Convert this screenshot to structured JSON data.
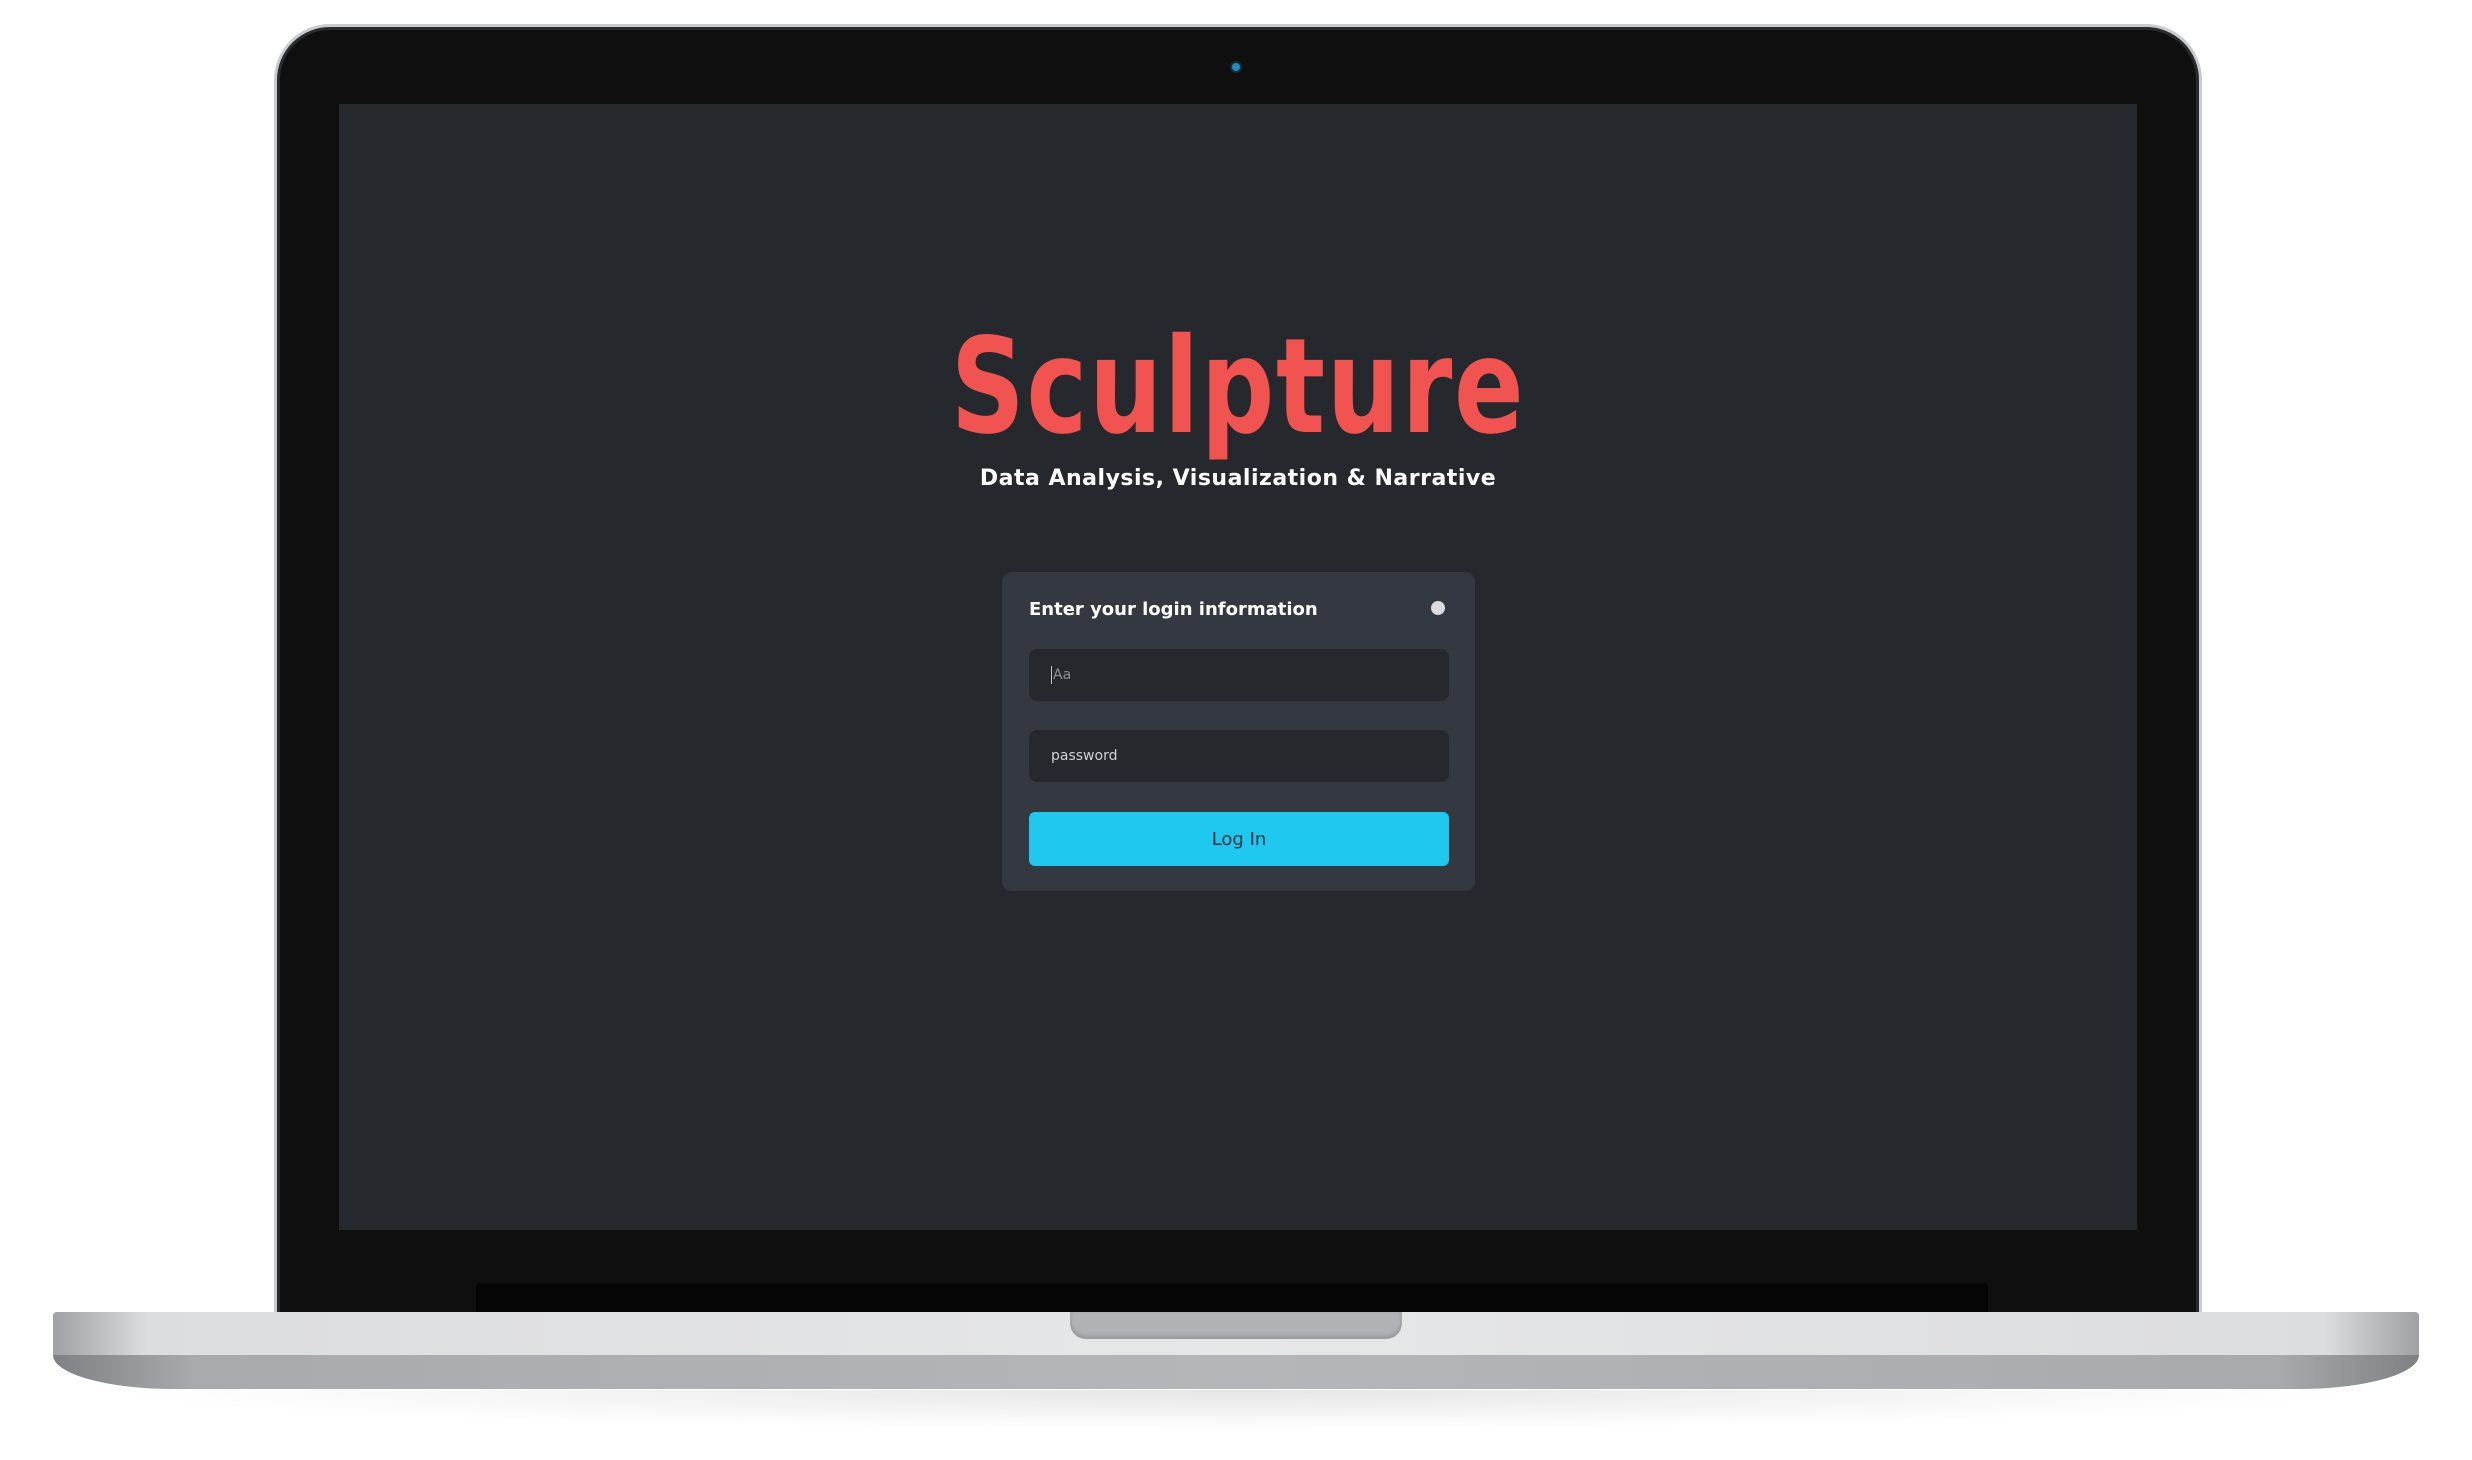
{
  "app": {
    "logo_text": "Sculpture",
    "tagline": "Data Analysis, Visualization & Narrative"
  },
  "login": {
    "title": "Enter your login information",
    "username_placeholder": "Aa",
    "password_placeholder": "password",
    "submit_label": "Log In"
  },
  "colors": {
    "screen_background": "#25282c",
    "card_background": "#343941",
    "logo": "#f05350",
    "button": "#1ec8ee"
  },
  "icons": {
    "status": "status-dot-icon",
    "camera": "camera-icon"
  }
}
